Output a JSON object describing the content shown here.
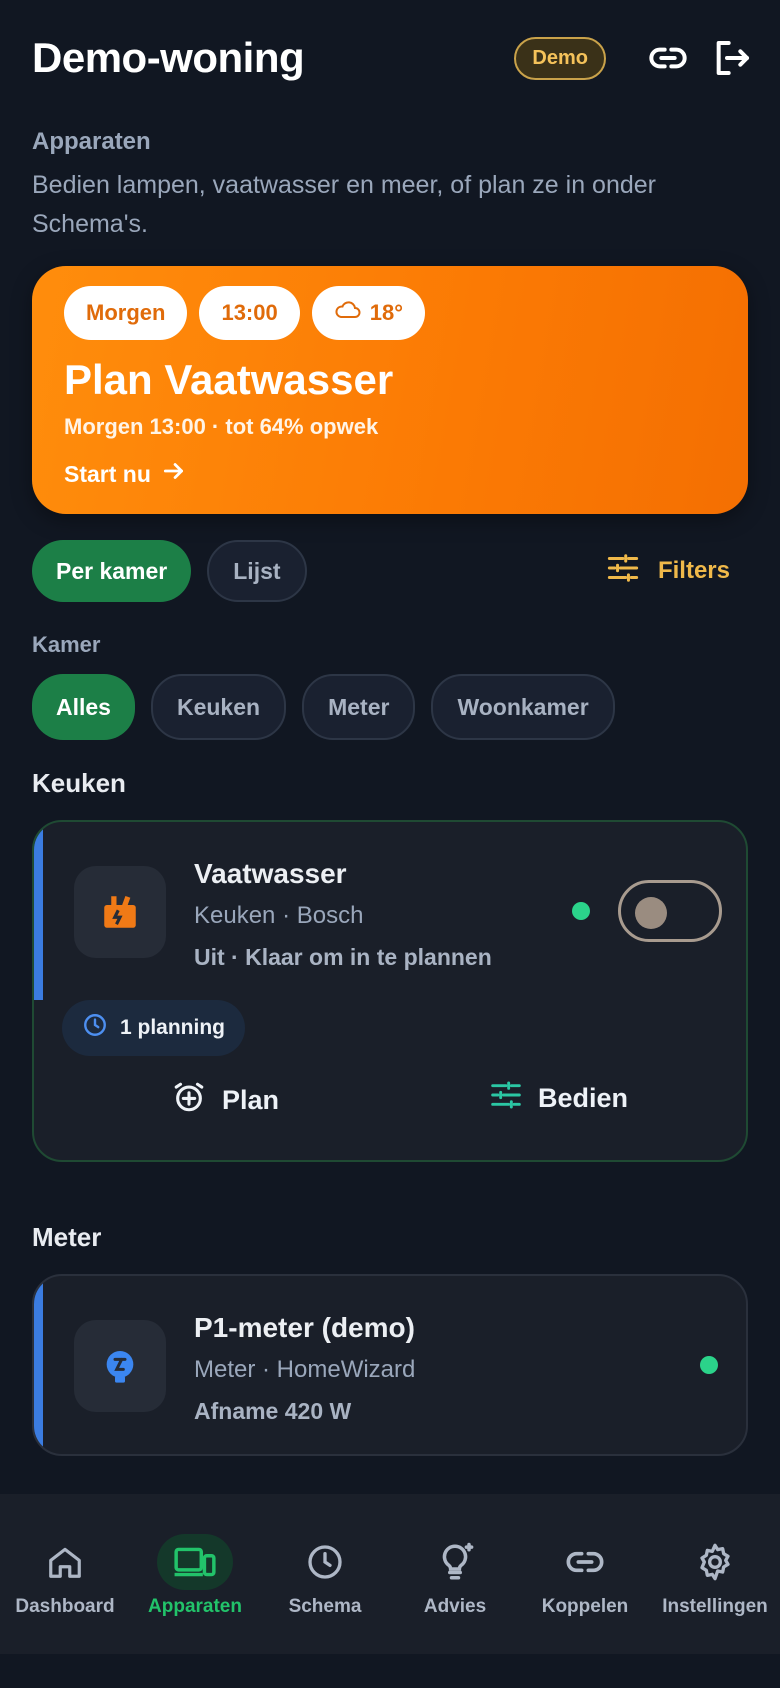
{
  "header": {
    "title": "Demo-woning",
    "badge": "Demo"
  },
  "section": {
    "title": "Apparaten",
    "description": "Bedien lampen, vaatwasser en meer, of plan ze in onder Schema's."
  },
  "hero": {
    "chips": {
      "day": "Morgen",
      "time": "13:00",
      "weather_icon": "cloud-icon",
      "temperature": "18°"
    },
    "title": "Plan Vaatwasser",
    "subtitle": "Morgen 13:00 · tot 64% opwek",
    "cta": "Start nu"
  },
  "view_toggle": {
    "by_room": "Per kamer",
    "list": "Lijst",
    "filters": "Filters"
  },
  "rooms": {
    "label": "Kamer",
    "items": [
      "Alles",
      "Keuken",
      "Meter",
      "Woonkamer"
    ],
    "selected": "Alles"
  },
  "groups": [
    {
      "title": "Keuken",
      "device": {
        "name": "Vaatwasser",
        "meta": "Keuken · Bosch",
        "status": "Uit · Klaar om in te plannen",
        "icon": "dishwasher-icon",
        "schedule_chip": "1 planning",
        "actions": {
          "plan": "Plan",
          "control": "Bedien"
        },
        "toggle_on": false
      }
    },
    {
      "title": "Meter",
      "device": {
        "name": "P1-meter (demo)",
        "meta": "Meter · HomeWizard",
        "status": "Afname 420 W",
        "icon": "meter-plug-icon"
      }
    }
  ],
  "nav": [
    {
      "label": "Dashboard",
      "icon": "home-icon"
    },
    {
      "label": "Apparaten",
      "icon": "devices-icon",
      "active": true
    },
    {
      "label": "Schema",
      "icon": "clock-icon"
    },
    {
      "label": "Advies",
      "icon": "lightbulb-icon"
    },
    {
      "label": "Koppelen",
      "icon": "link-icon"
    },
    {
      "label": "Instellingen",
      "icon": "gear-icon"
    }
  ],
  "colors": {
    "background": "#111722",
    "accent_green": "#1c7f47",
    "hero_orange": "#fb7a04",
    "filter_gold": "#f0b94a",
    "card_accent_blue": "#3b7ce0"
  }
}
